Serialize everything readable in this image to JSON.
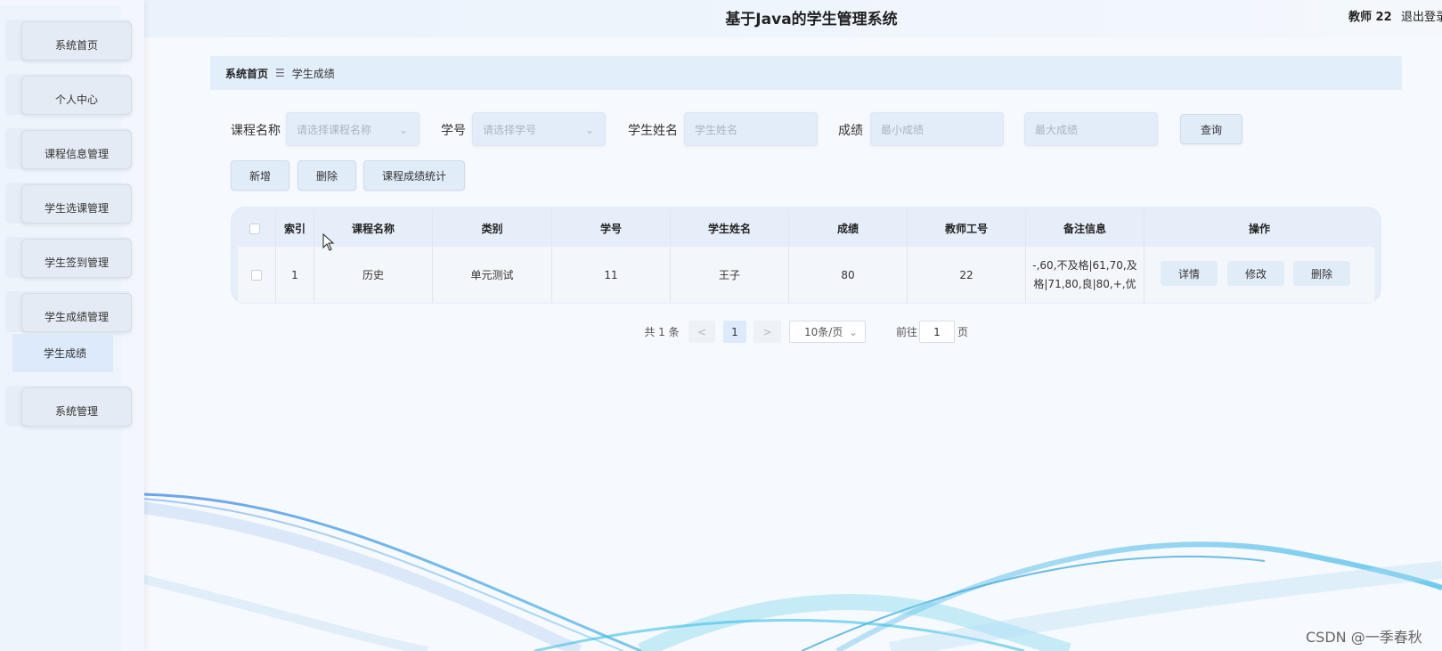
{
  "header": {
    "title": "基于Java的学生管理系统",
    "user": "教师 22",
    "logout": "退出登录"
  },
  "sidebar": {
    "items": [
      {
        "label": "系统首页"
      },
      {
        "label": "个人中心"
      },
      {
        "label": "课程信息管理"
      },
      {
        "label": "学生选课管理"
      },
      {
        "label": "学生签到管理"
      },
      {
        "label": "学生成绩管理"
      },
      {
        "label": "系统管理"
      }
    ],
    "subitem": "学生成绩"
  },
  "breadcrumb": {
    "home": "系统首页",
    "separator": "☰",
    "current": "学生成绩"
  },
  "search": {
    "course_label": "课程名称",
    "course_placeholder": "请选择课程名称",
    "student_no_label": "学号",
    "student_no_placeholder": "请选择学号",
    "student_name_label": "学生姓名",
    "student_name_placeholder": "学生姓名",
    "score_label": "成绩",
    "min_score_placeholder": "最小成绩",
    "max_score_placeholder": "最大成绩",
    "query_button": "查询"
  },
  "actions": {
    "add": "新增",
    "delete": "删除",
    "stats": "课程成绩统计"
  },
  "table": {
    "columns": [
      "索引",
      "课程名称",
      "类别",
      "学号",
      "学生姓名",
      "成绩",
      "教师工号",
      "备注信息",
      "操作"
    ],
    "rows": [
      {
        "index": "1",
        "course": "历史",
        "category": "单元测试",
        "student_no": "11",
        "student_name": "王子",
        "score": "80",
        "teacher_no": "22",
        "remark_line1": "-,60,不及格|61,70,及",
        "remark_line2": "格|71,80,良|80,+,优",
        "detail": "详情",
        "edit": "修改",
        "delete": "删除"
      }
    ]
  },
  "pagination": {
    "total": "共 1 条",
    "prev": "<",
    "current_page": "1",
    "next": ">",
    "page_size": "10条/页",
    "goto_label": "前往",
    "goto_value": "1",
    "page_suffix": "页"
  },
  "watermark": "CSDN @一季春秋",
  "colors": {
    "accent": "#e1ecf9",
    "header_bg": "#eaf2fc",
    "breadcrumb_bg": "#e3eefb"
  }
}
